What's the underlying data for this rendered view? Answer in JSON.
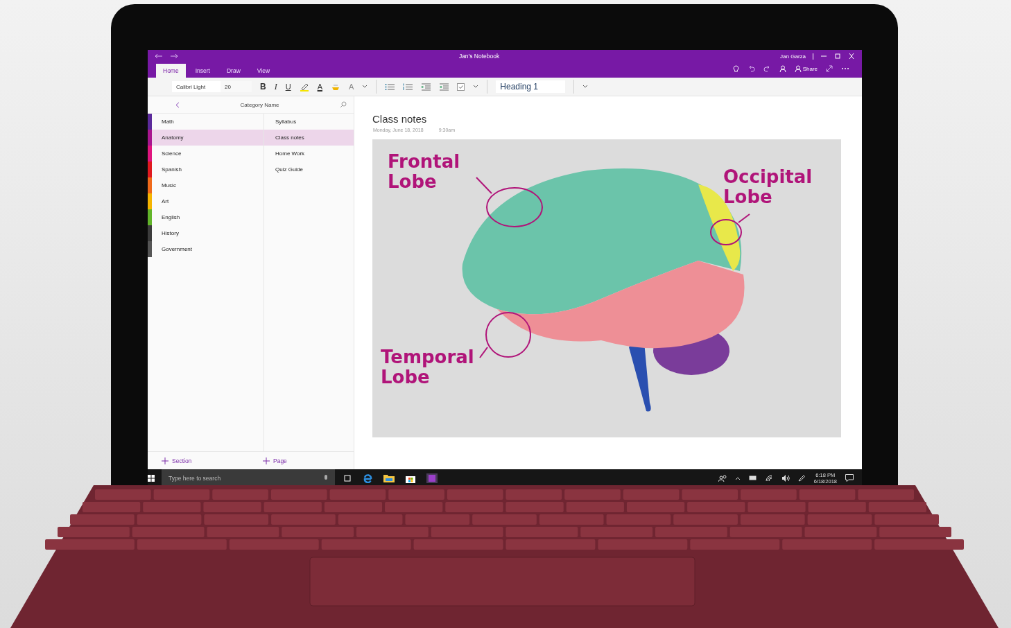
{
  "window": {
    "title": "Jan's Notebook",
    "user": "Jan Garza",
    "share": "Share"
  },
  "ribbon_tabs": [
    {
      "label": "Home",
      "selected": true
    },
    {
      "label": "Insert",
      "selected": false
    },
    {
      "label": "Draw",
      "selected": false
    },
    {
      "label": "View",
      "selected": false
    }
  ],
  "toolbar": {
    "font": "Calibri Light",
    "size": "20",
    "style": "Heading 1",
    "format_buttons": [
      {
        "kind": "bold",
        "label": "B"
      },
      {
        "kind": "italic",
        "label": "I"
      },
      {
        "kind": "underline",
        "label": "U"
      },
      {
        "kind": "highlight"
      },
      {
        "kind": "font-color",
        "label": "A"
      },
      {
        "kind": "eraser"
      },
      {
        "kind": "clear",
        "label": "A"
      }
    ]
  },
  "nav": {
    "title": "Category Name",
    "sections": [
      {
        "label": "Math",
        "color": "#5b2a9b",
        "selected": false
      },
      {
        "label": "Anatomy",
        "color": "#a8168f",
        "selected": true
      },
      {
        "label": "Science",
        "color": "#e0157f",
        "selected": false
      },
      {
        "label": "Spanish",
        "color": "#e0191f",
        "selected": false
      },
      {
        "label": "Music",
        "color": "#f06a1a",
        "selected": false
      },
      {
        "label": "Art",
        "color": "#f5b400",
        "selected": false
      },
      {
        "label": "English",
        "color": "#62b52a",
        "selected": false
      },
      {
        "label": "History",
        "color": "#3c3c3c",
        "selected": false
      },
      {
        "label": "Government",
        "color": "#555555",
        "selected": false
      }
    ],
    "pages": [
      {
        "label": "Syllabus",
        "selected": false
      },
      {
        "label": "Class notes",
        "selected": true
      },
      {
        "label": "Home Work",
        "selected": false
      },
      {
        "label": "Quiz Guide",
        "selected": false
      }
    ],
    "add_section": "Section",
    "add_page": "Page"
  },
  "page": {
    "title": "Class notes",
    "date": "Monday, June 18, 2018",
    "time": "9:30am",
    "ink_labels": [
      {
        "text": "Frontal Lobe"
      },
      {
        "text": "Occipital Lobe"
      },
      {
        "text": "Temporal Lobe"
      }
    ]
  },
  "taskbar": {
    "search_placeholder": "Type here to search",
    "time": "6:18 PM",
    "date": "6/18/2018"
  }
}
